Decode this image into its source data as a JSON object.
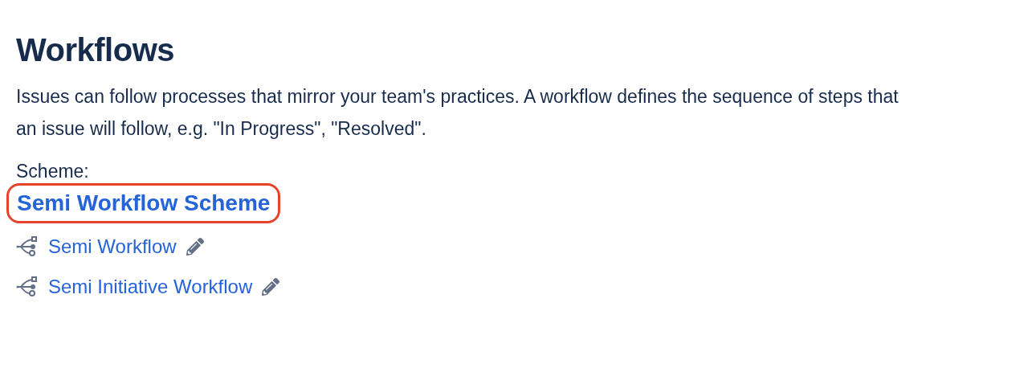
{
  "title": "Workflows",
  "description": "Issues can follow processes that mirror your team's practices. A workflow defines the sequence of steps that an issue will follow, e.g. \"In Progress\", \"Resolved\".",
  "scheme": {
    "label": "Scheme:",
    "name": "Semi Workflow Scheme",
    "highlighted": true
  },
  "workflows": [
    {
      "name": "Semi Workflow"
    },
    {
      "name": "Semi Initiative Workflow"
    }
  ]
}
